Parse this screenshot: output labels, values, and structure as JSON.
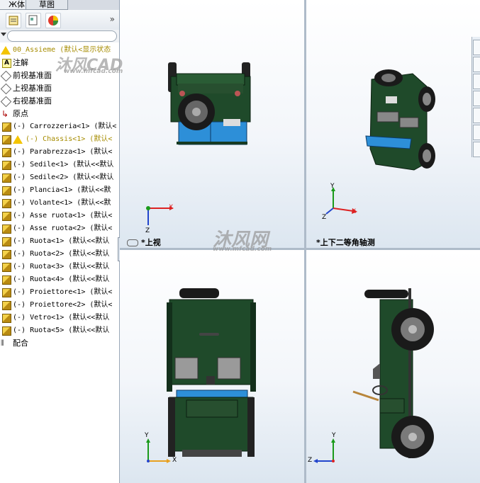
{
  "panel": {
    "tab_features": "Ж体",
    "tab_config": "草图",
    "tree_items": [
      {
        "label": "00_Assieme  (默认<显示状态",
        "icon": "warning-icon",
        "style": "warn-mono"
      },
      {
        "label": "注解",
        "icon": "annotation-icon",
        "style": "normal"
      },
      {
        "label": "前视基准面",
        "icon": "plane-icon",
        "style": "normal"
      },
      {
        "label": "上视基准面",
        "icon": "plane-icon",
        "style": "normal"
      },
      {
        "label": "右视基准面",
        "icon": "plane-icon",
        "style": "normal"
      },
      {
        "label": "原点",
        "icon": "origin-icon",
        "style": "normal"
      },
      {
        "label": "(-) Carrozzeria<1> (默认<",
        "icon": "component-icon",
        "style": "mono"
      },
      {
        "label": "(-) Chassis<1> (默认<",
        "icon": "component-warning-icon",
        "style": "warn-mono"
      },
      {
        "label": "(-) Parabrezza<1> (默认<",
        "icon": "component-icon",
        "style": "mono"
      },
      {
        "label": "(-) Sedile<1> (默认<<默认",
        "icon": "component-icon",
        "style": "mono"
      },
      {
        "label": "(-) Sedile<2> (默认<<默认",
        "icon": "component-icon",
        "style": "mono"
      },
      {
        "label": "(-) Plancia<1> (默认<<默",
        "icon": "component-icon",
        "style": "mono"
      },
      {
        "label": "(-) Volante<1> (默认<<默",
        "icon": "component-icon",
        "style": "mono"
      },
      {
        "label": "(-) Asse ruota<1> (默认<",
        "icon": "component-icon",
        "style": "mono"
      },
      {
        "label": "(-) Asse ruota<2> (默认<",
        "icon": "component-icon",
        "style": "mono"
      },
      {
        "label": "(-) Ruota<1> (默认<<默认",
        "icon": "component-icon",
        "style": "mono"
      },
      {
        "label": "(-) Ruota<2> (默认<<默认",
        "icon": "component-icon",
        "style": "mono"
      },
      {
        "label": "(-) Ruota<3> (默认<<默认",
        "icon": "component-icon",
        "style": "mono"
      },
      {
        "label": "(-) Ruota<4> (默认<<默认",
        "icon": "component-icon",
        "style": "mono"
      },
      {
        "label": "(-) Proiettore<1> (默认<",
        "icon": "component-icon",
        "style": "mono"
      },
      {
        "label": "(-) Proiettore<2> (默认<",
        "icon": "component-icon",
        "style": "mono"
      },
      {
        "label": "(-) Vetro<1> (默认<<默认",
        "icon": "component-icon",
        "style": "mono"
      },
      {
        "label": "(-) Ruota<5> (默认<<默认",
        "icon": "component-icon",
        "style": "mono"
      },
      {
        "label": "配合",
        "icon": "mates-icon",
        "style": "normal"
      }
    ]
  },
  "viewports": {
    "top_view_label": "*上视",
    "trimetric_label": "*上下二等角轴测"
  },
  "watermarks": {
    "logo_text": "沐风CAD",
    "site_text": "www.mfcad.com",
    "center_text": "沐风网",
    "center_site": "www.mfcad.com"
  },
  "triad": {
    "x": "X",
    "y": "Y",
    "z": "Z"
  },
  "colors": {
    "body_green": "#1f4a2a",
    "accent_blue": "#2d8fd8",
    "axis_red": "#d22",
    "axis_green": "#1a9a1a",
    "axis_blue": "#2244cc"
  }
}
